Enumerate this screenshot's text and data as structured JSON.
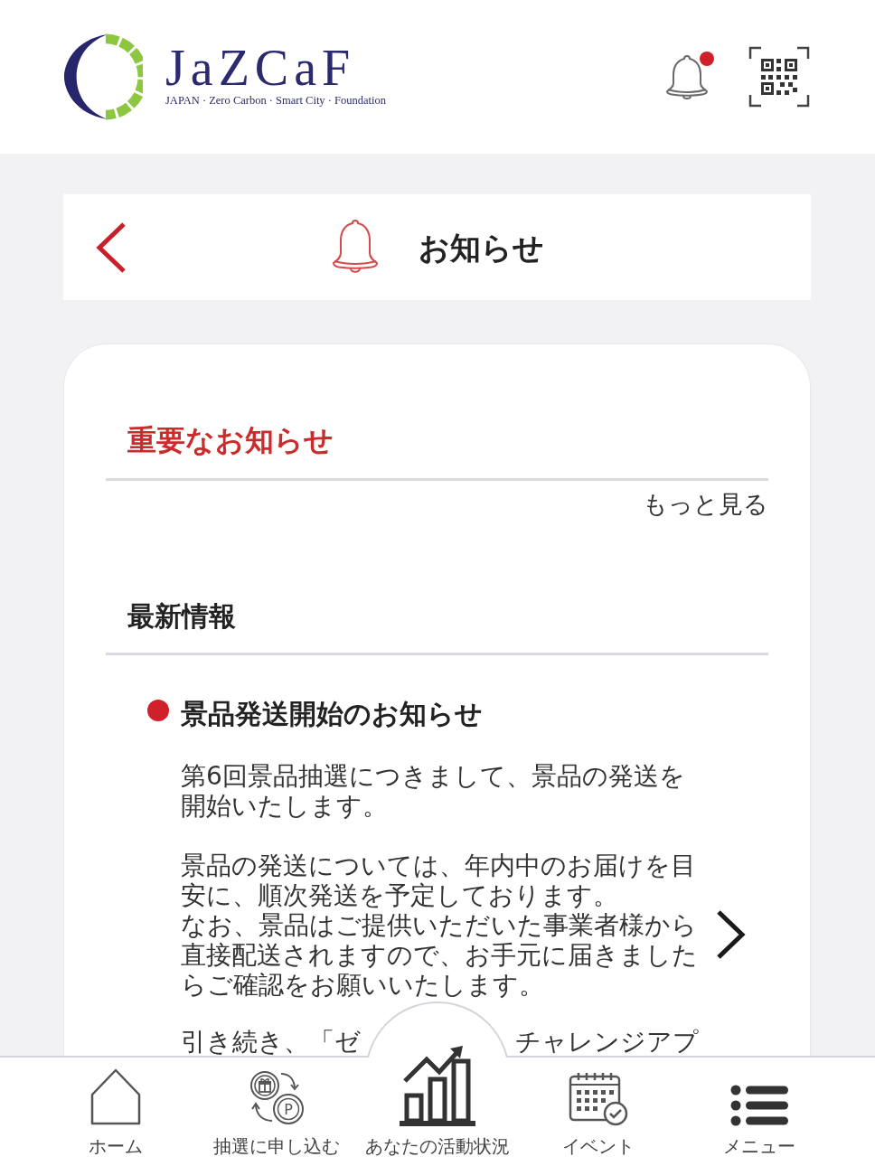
{
  "header": {
    "logo": {
      "wordmark": "JaZCaF",
      "tagline": "JAPAN · Zero Carbon · Smart City · Foundation"
    },
    "bell": {
      "unread": true
    }
  },
  "title_bar": {
    "title": "お知らせ"
  },
  "important": {
    "heading": "重要なお知らせ",
    "more_link": "もっと見る"
  },
  "latest": {
    "heading": "最新情報",
    "items": [
      {
        "title": "景品発送開始のお知らせ",
        "unread": true,
        "paragraphs": [
          [
            "第6回景品抽選につきまして、景品の発送を開始いたします。"
          ],
          [
            "景品の発送については、年内中のお届けを目安に、順次発送を予定しております。",
            "なお、景品はご提供いただいた事業者様から直接配送されますので、お手元に届きましたらご確認をお願いいたします。"
          ]
        ],
        "cut_line": [
          "引き続き、「ゼ",
          "チャレンジアプ"
        ]
      }
    ]
  },
  "bottom_nav": {
    "items": [
      {
        "kind": "home",
        "label": "ホーム",
        "raised": false
      },
      {
        "kind": "lottery",
        "label": "抽選に申し込む",
        "raised": false,
        "coin_mark": "P"
      },
      {
        "kind": "activity",
        "label": "あなたの活動状況",
        "raised": true
      },
      {
        "kind": "event",
        "label": "イベント",
        "raised": false
      },
      {
        "kind": "menu",
        "label": "メニュー",
        "raised": false
      }
    ]
  }
}
